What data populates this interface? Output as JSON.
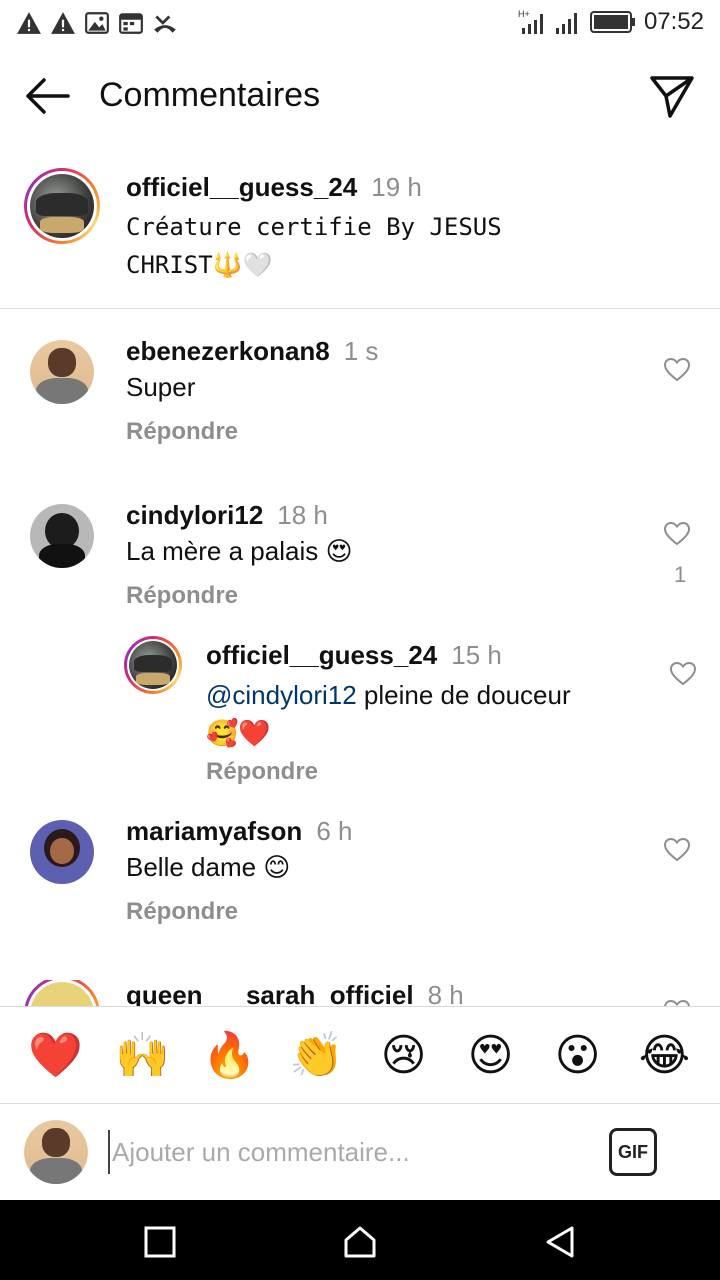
{
  "status_bar": {
    "time": "07:52",
    "left_icons": [
      "warning-icon",
      "warning-icon",
      "image-icon",
      "calendar-icon",
      "missed-call-icon"
    ],
    "right_icons": [
      "signal-h-plus-icon",
      "signal-icon",
      "battery-icon"
    ]
  },
  "header": {
    "title": "Commentaires",
    "back_icon": "arrow-left-icon",
    "send_icon": "paper-plane-icon"
  },
  "caption": {
    "username": "officiel__guess_24",
    "time": "19 h",
    "text_line1": "Créature certifie By JESUS",
    "text_line2": "CHRIST🔱🤍"
  },
  "comments": [
    {
      "username": "ebenezerkonan8",
      "time": "1 s",
      "text": "Super",
      "reply_label": "Répondre",
      "likes": ""
    },
    {
      "username": "cindylori12",
      "time": "18 h",
      "text": "La mère a palais 😍",
      "reply_label": "Répondre",
      "likes": "1"
    },
    {
      "username": "officiel__guess_24",
      "time": "15 h",
      "mention": "@cindylori12",
      "text": " pleine de douceur",
      "text_line2": "🥰❤️",
      "reply_label": "Répondre",
      "likes": ""
    },
    {
      "username": "mariamyafson",
      "time": "6 h",
      "text": "Belle dame 😊",
      "reply_label": "Répondre",
      "likes": ""
    },
    {
      "username": "queen___sarah_officiel",
      "time": "8 h",
      "text": "",
      "reply_label": "",
      "likes": ""
    }
  ],
  "emoji_bar": [
    "❤️",
    "🙌",
    "🔥",
    "👏",
    "😢",
    "😍",
    "😮",
    "😂"
  ],
  "input": {
    "placeholder": "Ajouter un commentaire...",
    "gif_label": "GIF"
  },
  "nav_bar": [
    "recents-icon",
    "home-icon",
    "back-icon"
  ]
}
